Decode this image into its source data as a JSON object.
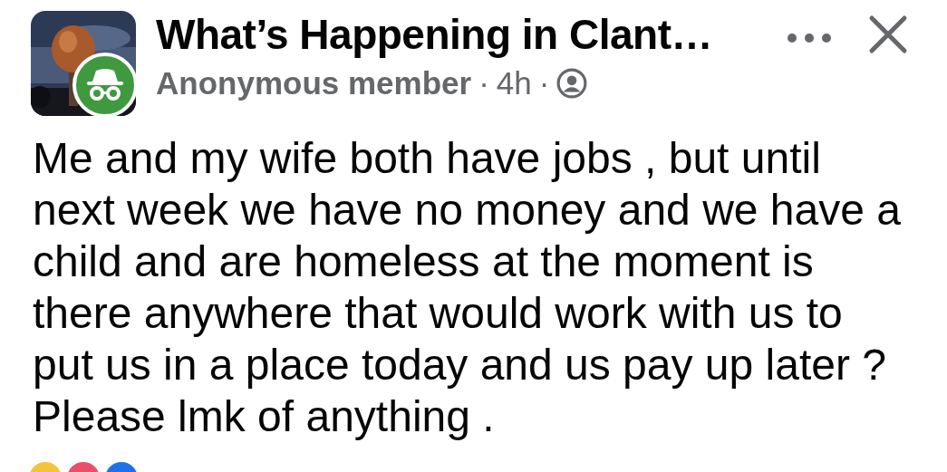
{
  "post": {
    "group_name": "What’s Happening in Clant…",
    "author": "Anonymous member",
    "separator_1": "·",
    "time": "4h",
    "separator_2": "·",
    "body_lines": [
      "Me and my wife both have jobs , but until",
      "next week we have no money and we have a",
      "child and are homeless at the moment is",
      "there anywhere that would work with us to",
      "put us in a place today and us pay up later ?",
      "Please lmk of anything ."
    ]
  }
}
